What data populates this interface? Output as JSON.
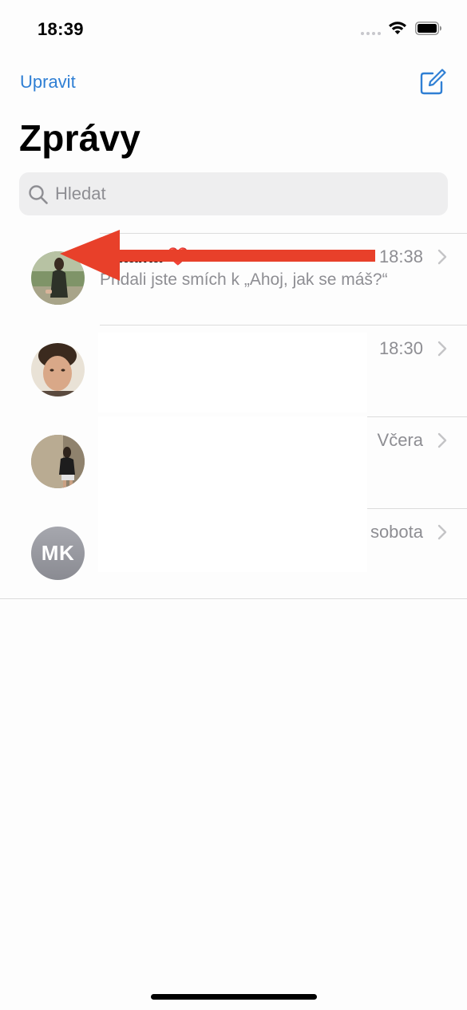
{
  "status_bar": {
    "time": "18:39"
  },
  "nav": {
    "edit_label": "Upravit"
  },
  "title": "Zprávy",
  "search": {
    "placeholder": "Hledat"
  },
  "conversations": [
    {
      "name": "Natálka ❤️",
      "preview": "Přidali jste smích k „Ahoj, jak se máš?“",
      "time": "18:38",
      "avatar": "photo"
    },
    {
      "name": "",
      "preview": "",
      "time": "18:30",
      "avatar": "photo"
    },
    {
      "name": "",
      "preview": "",
      "time": "Včera",
      "avatar": "photo"
    },
    {
      "name": "",
      "preview": "",
      "time": "sobota",
      "avatar_initials": "MK"
    }
  ],
  "colors": {
    "accent": "#2f7fd4",
    "arrow": "#e8402a",
    "secondary_text": "#8e8e93"
  }
}
